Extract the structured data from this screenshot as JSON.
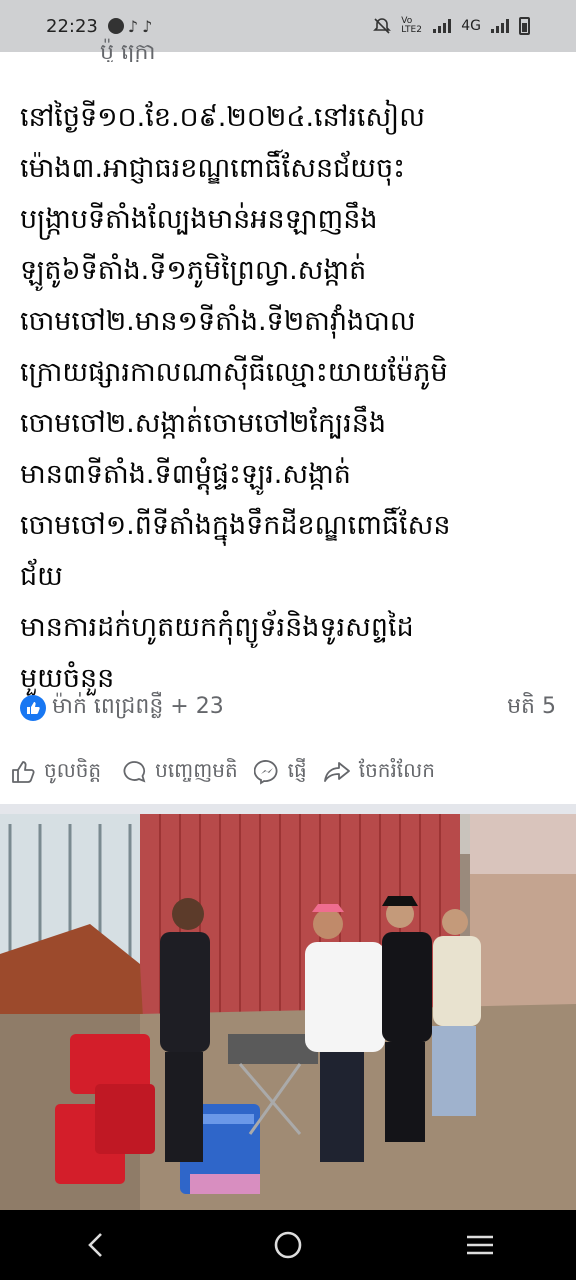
{
  "status_bar": {
    "time": "22:23",
    "network_label": "4G",
    "volte_label": "Vo LTE2",
    "icons": [
      "messenger-icon",
      "tiktok-icon",
      "tiktok-icon",
      "mute-icon",
      "signal-icon",
      "battery-icon"
    ]
  },
  "post": {
    "cutoff_header": "ប៉ូ ក្រោ",
    "text_lines": [
      "នៅថ្ងៃទី១០.ខែ.០៩.២០២៤.នៅរសៀល",
      "ម៉ោង៣.អាជ្ញាធរខណ្ឌពោធិ៍សែនជ័យចុះ",
      "បង្ក្រាបទីតាំងល្បែងមាន់អនឡាញនឹង",
      "ឡូតូ៦ទីតាំង.ទី១ភូមិព្រៃល្វា.សង្កាត់",
      "ចោមចៅ២.មាន១ទីតាំង.ទី២តាវ៉ាំងបាល",
      "ក្រោយផ្សារកាលណាស៊ីធីឈ្មោះយាយម៉ែភូមិ",
      "ចោមចៅ២.សង្កាត់ចោមចៅ២ក្បែរនឹង",
      "មាន៣ទីតាំង.ទី៣ម្តុំផ្ទះឡូរ.សង្កាត់",
      "ចោមចៅ១.ពីទីតាំងក្នុងទឹកដីខណ្ឌពោធិ៍សែន",
      "ជ័យ",
      "មានការដក់ហូតយកកុំព្យូទ័រនិងទូរសព្ទដៃ",
      "មួយចំនួន"
    ],
    "reactions_text": "ម៉ាក់ ពេជ្រពន្លឺ + 23",
    "comments_text": "មតិ 5"
  },
  "actions": {
    "like_label": "ចូលចិត្ត",
    "comment_label": "បញ្ចេញមតិ",
    "send_label": "ផ្ញើ",
    "share_label": "ចែករំលែក"
  },
  "colors": {
    "accent": "#1877f2",
    "status_bar_bg": "#cfd0d2",
    "nav_bar_bg": "#000000",
    "meta_text": "#65676b"
  }
}
